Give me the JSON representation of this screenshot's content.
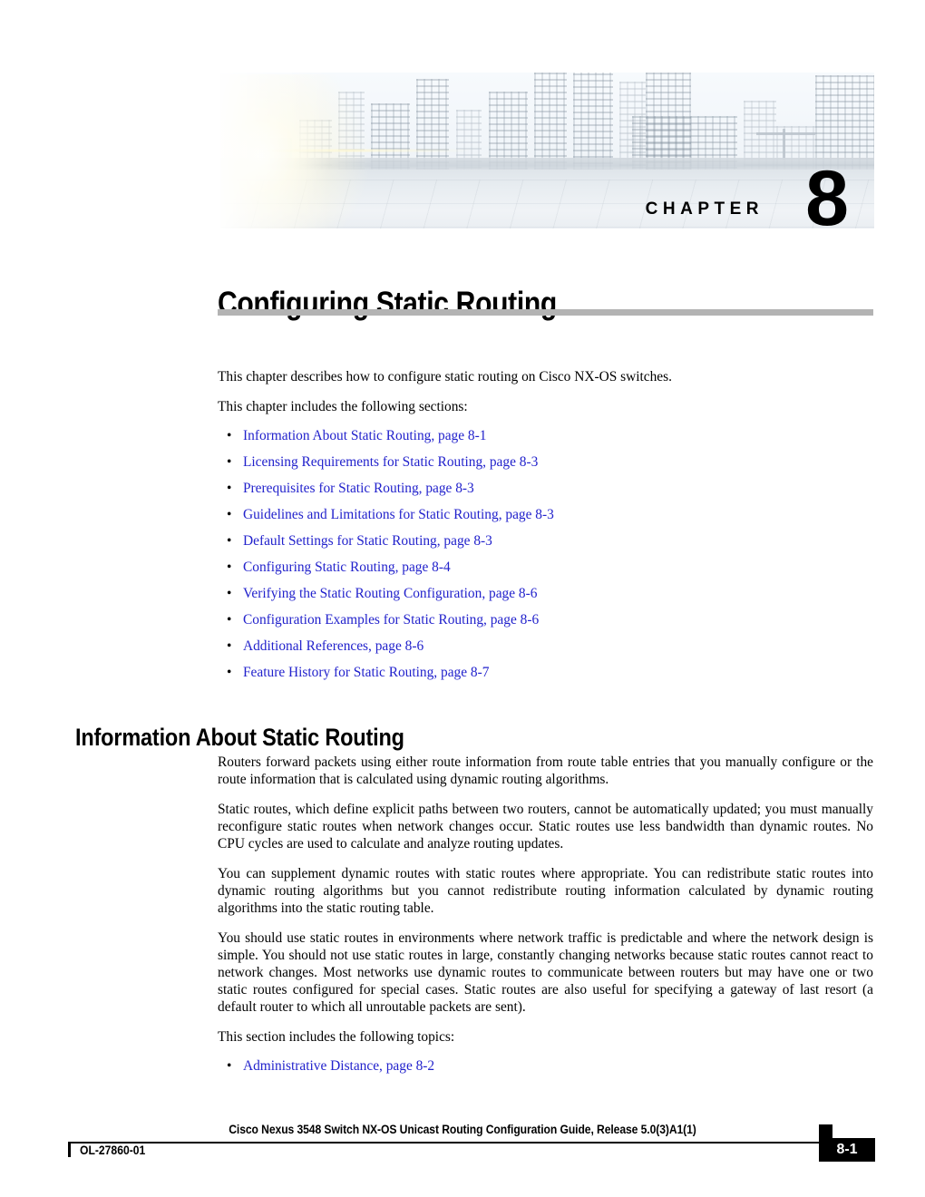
{
  "banner": {
    "chapter_label": "CHAPTER",
    "chapter_number": "8",
    "image_name": "city-skyline-rooftop-photo"
  },
  "chapter": {
    "title": "Configuring Static Routing"
  },
  "intro": {
    "line1": "This chapter describes how to configure static routing on Cisco NX-OS switches.",
    "line2": "This chapter includes the following sections:"
  },
  "toc": {
    "bullet_glyph": "•",
    "items": [
      {
        "label": "Information About Static Routing, page 8-1"
      },
      {
        "label": "Licensing Requirements for Static Routing, page 8-3"
      },
      {
        "label": "Prerequisites for Static Routing, page 8-3"
      },
      {
        "label": "Guidelines and Limitations for Static Routing, page 8-3"
      },
      {
        "label": "Default Settings for Static Routing, page 8-3"
      },
      {
        "label": "Configuring Static Routing, page 8-4"
      },
      {
        "label": "Verifying the Static Routing Configuration, page 8-6"
      },
      {
        "label": "Configuration Examples for Static Routing, page 8-6"
      },
      {
        "label": "Additional References, page 8-6"
      },
      {
        "label": "Feature History for Static Routing, page 8-7"
      }
    ]
  },
  "section": {
    "heading": "Information About Static Routing",
    "paragraphs": [
      "Routers forward packets using either route information from route table entries that you manually configure or the route information that is calculated using dynamic routing algorithms.",
      "Static routes, which define explicit paths between two routers, cannot be automatically updated; you must manually reconfigure static routes when network changes occur. Static routes use less bandwidth than dynamic routes. No CPU cycles are used to calculate and analyze routing updates.",
      "You can supplement dynamic routes with static routes where appropriate. You can redistribute static routes into dynamic routing algorithms but you cannot redistribute routing information calculated by dynamic routing algorithms into the static routing table.",
      "You should use static routes in environments where network traffic is predictable and where the network design is simple. You should not use static routes in large, constantly changing networks because static routes cannot react to network changes. Most networks use dynamic routes to communicate between routers but may have one or two static routes configured for special cases. Static routes are also useful for specifying a gateway of last resort (a default router to which all unroutable packets are sent)."
    ],
    "topics_lead": "This section includes the following topics:",
    "topics": [
      {
        "label": "Administrative Distance, page 8-2"
      }
    ]
  },
  "footer": {
    "doc_title": "Cisco Nexus 3548 Switch  NX-OS Unicast Routing Configuration Guide, Release 5.0(3)A1(1)",
    "doc_id": "OL-27860-01",
    "page_number": "8-1"
  },
  "colors": {
    "link": "#2222cc",
    "title_rule": "#b3b3b3",
    "footer_bar": "#000000"
  }
}
